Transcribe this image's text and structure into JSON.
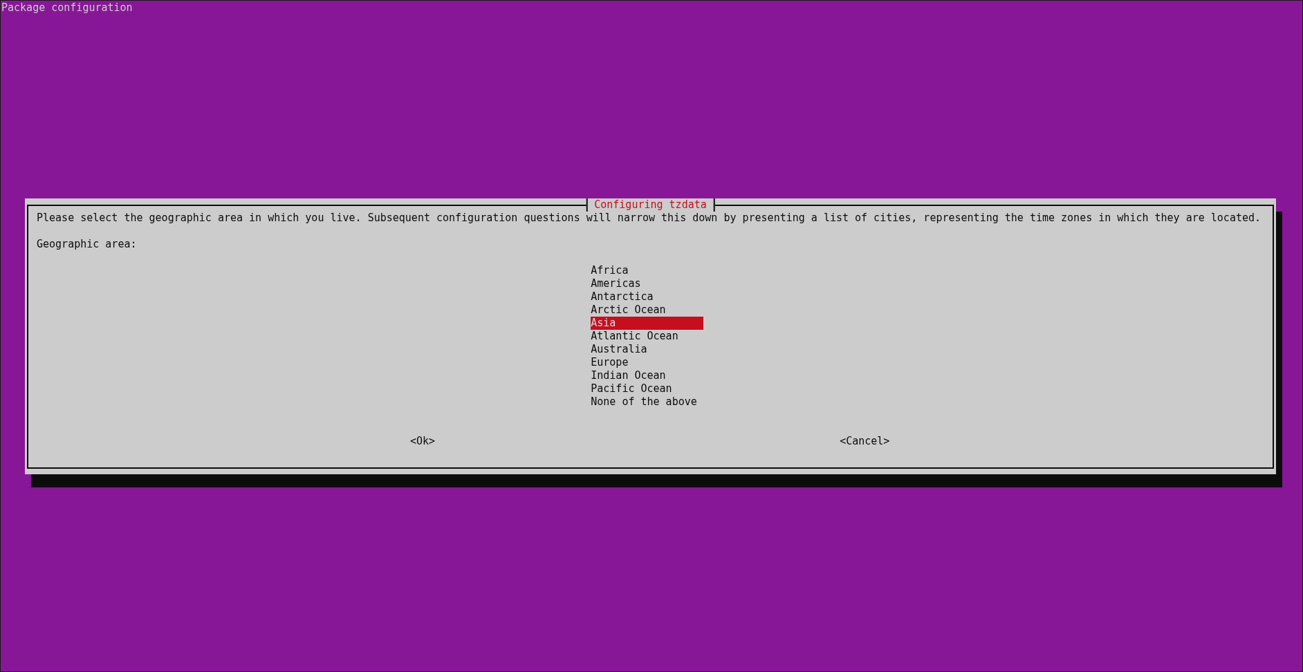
{
  "window": {
    "title": "Package configuration"
  },
  "dialog": {
    "title": "Configuring tzdata",
    "message": "Please select the geographic area in which you live. Subsequent configuration questions will narrow this down by presenting a list of cities, representing the time zones in which they are located.",
    "prompt": "Geographic area:",
    "menu": {
      "items": [
        {
          "label": "Africa",
          "selected": false
        },
        {
          "label": "Americas",
          "selected": false
        },
        {
          "label": "Antarctica",
          "selected": false
        },
        {
          "label": "Arctic Ocean",
          "selected": false
        },
        {
          "label": "Asia",
          "selected": true
        },
        {
          "label": "Atlantic Ocean",
          "selected": false
        },
        {
          "label": "Australia",
          "selected": false
        },
        {
          "label": "Europe",
          "selected": false
        },
        {
          "label": "Indian Ocean",
          "selected": false
        },
        {
          "label": "Pacific Ocean",
          "selected": false
        },
        {
          "label": "None of the above",
          "selected": false
        }
      ]
    },
    "buttons": [
      "<Ok>",
      "<Cancel>"
    ]
  }
}
